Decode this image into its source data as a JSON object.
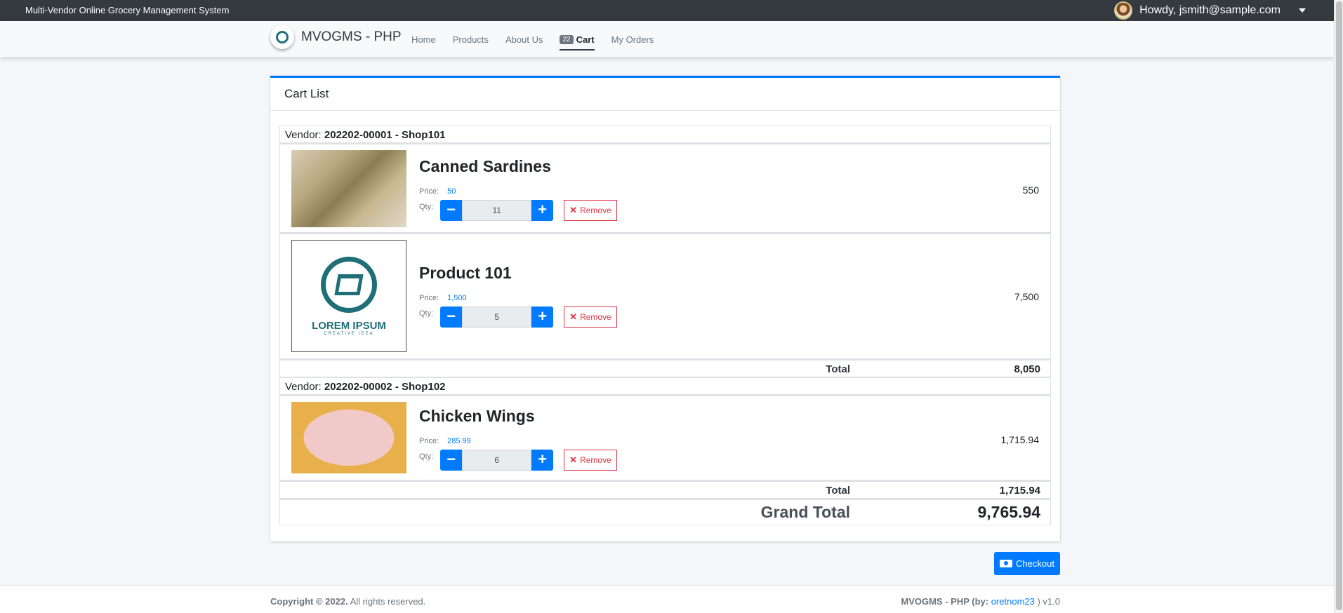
{
  "topbar": {
    "system_title": "Multi-Vendor Online Grocery Management System",
    "greeting": "Howdy, jsmith@sample.com"
  },
  "navbar": {
    "brand": "MVOGMS - PHP",
    "links": [
      {
        "label": "Home"
      },
      {
        "label": "Products"
      },
      {
        "label": "About Us"
      },
      {
        "label": "Cart",
        "badge": "22"
      },
      {
        "label": "My Orders"
      }
    ]
  },
  "cart": {
    "title": "Cart List",
    "vendors": [
      {
        "label": "Vendor:",
        "code": "202202-00001 - Shop101",
        "items": [
          {
            "name": "Canned Sardines",
            "price_label": "Price:",
            "price": "50",
            "qty_label": "Qty:",
            "qty": "11",
            "remove_label": "Remove",
            "subtotal": "550"
          },
          {
            "name": "Product 101",
            "price_label": "Price:",
            "price": "1,500",
            "qty_label": "Qty:",
            "qty": "5",
            "remove_label": "Remove",
            "subtotal": "7,500",
            "image_text": "LOREM IPSUM",
            "image_subtext": "CREATIVE IDEA"
          }
        ],
        "total_label": "Total",
        "total": "8,050"
      },
      {
        "label": "Vendor:",
        "code": "202202-00002 - Shop102",
        "items": [
          {
            "name": "Chicken Wings",
            "price_label": "Price:",
            "price": "285.99",
            "qty_label": "Qty:",
            "qty": "6",
            "remove_label": "Remove",
            "subtotal": "1,715.94"
          }
        ],
        "total_label": "Total",
        "total": "1,715.94"
      }
    ],
    "grand_total_label": "Grand Total",
    "grand_total": "9,765.94",
    "checkout_label": "Checkout"
  },
  "footer": {
    "copyright_prefix": "Copyright © 2022.",
    "copyright_suffix": "All rights reserved.",
    "version_prefix": "MVOGMS - PHP (by:",
    "author": "oretnom23",
    "version_suffix": ") v1.0"
  },
  "colors": {
    "primary": "#007bff",
    "danger": "#dc3545",
    "topbar": "#343a40",
    "logo_teal": "#1f6f78"
  }
}
